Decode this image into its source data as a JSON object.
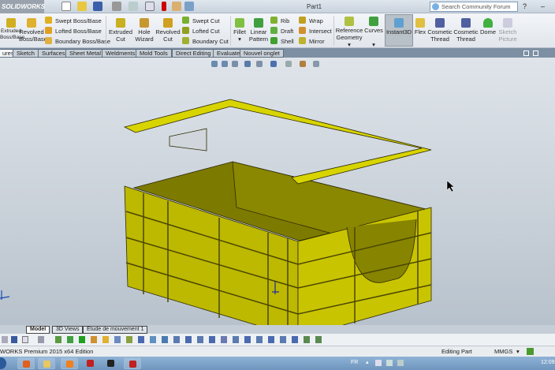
{
  "app": {
    "logo": "SOLIDWORKS",
    "document_title": "Part1",
    "search_placeholder": "Search Community Forum"
  },
  "ribbon": {
    "large": [
      "Extruded Boss/Base",
      "Revolved Boss/Base",
      "Extruded Cut",
      "Hole Wizard",
      "Revolved Cut",
      "Fillet",
      "Linear Pattern",
      "Reference Geometry",
      "Curves",
      "Instant3D",
      "Flex",
      "Cosmetic Thread",
      "Cosmetic Thread",
      "Dome",
      "Sketch Picture"
    ],
    "large_lines": [
      [
        "ded",
        "Base"
      ],
      [
        "Revolved",
        "Boss/Base"
      ],
      [
        "Extruded",
        "Cut"
      ],
      [
        "Hole",
        "Wizard"
      ],
      [
        "Revolved",
        "Cut"
      ],
      [
        "Fillet",
        ""
      ],
      [
        "Linear",
        "Pattern"
      ],
      [
        "Reference",
        "Geometry"
      ],
      [
        "Curves",
        ""
      ],
      [
        "Instant3D",
        ""
      ],
      [
        "Flex",
        ""
      ],
      [
        "Cosmetic",
        "Thread"
      ],
      [
        "Cosmetic",
        "Thread"
      ],
      [
        "Dome",
        ""
      ],
      [
        "Sketch",
        "Picture"
      ]
    ],
    "small": {
      "boss": [
        "Swept Boss/Base",
        "Lofted Boss/Base",
        "Boundary Boss/Base"
      ],
      "cut": [
        "Swept Cut",
        "Lofted Cut",
        "Boundary Cut"
      ],
      "features": [
        "Rib",
        "Draft",
        "Shell"
      ],
      "features2": [
        "Wrap",
        "Intersect",
        "Mirror"
      ]
    }
  },
  "tabs": [
    "ures",
    "Sketch",
    "Surfaces",
    "Sheet Metal",
    "Weldments",
    "Mold Tools",
    "Direct Editing",
    "Evaluate",
    "Nouvel onglet"
  ],
  "bottom_tabs": [
    "Model",
    "3D Views",
    "Etude de mouvement 1"
  ],
  "status": {
    "edition": "WORKS Premium 2015 x64 Edition",
    "mode": "Editing Part",
    "units": "MMGS",
    "units_arrow": "▾"
  },
  "taskbar": {
    "lang": "FR",
    "time": "12:09"
  },
  "colors": {
    "part": "#c9c400",
    "part_dark": "#8a8600",
    "accent": "#3a7bd5"
  }
}
